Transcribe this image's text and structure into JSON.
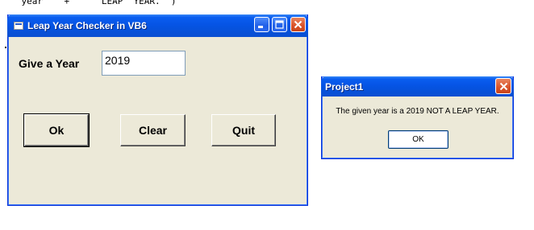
{
  "background": {
    "code_snippet": "  \" year \"  +  \"   LEAP  YEAR.\" )"
  },
  "main_window": {
    "title": "Leap Year Checker in VB6",
    "year_label": "Give a Year",
    "year_value": "2019",
    "buttons": {
      "ok": "Ok",
      "clear": "Clear",
      "quit": "Quit"
    }
  },
  "message_box": {
    "title": "Project1",
    "message": "The given year is a 2019 NOT A LEAP YEAR.",
    "ok_label": "OK"
  },
  "colors": {
    "titlebar_blue": "#0554e3",
    "close_red": "#d9532a",
    "window_face": "#ece9d8"
  }
}
